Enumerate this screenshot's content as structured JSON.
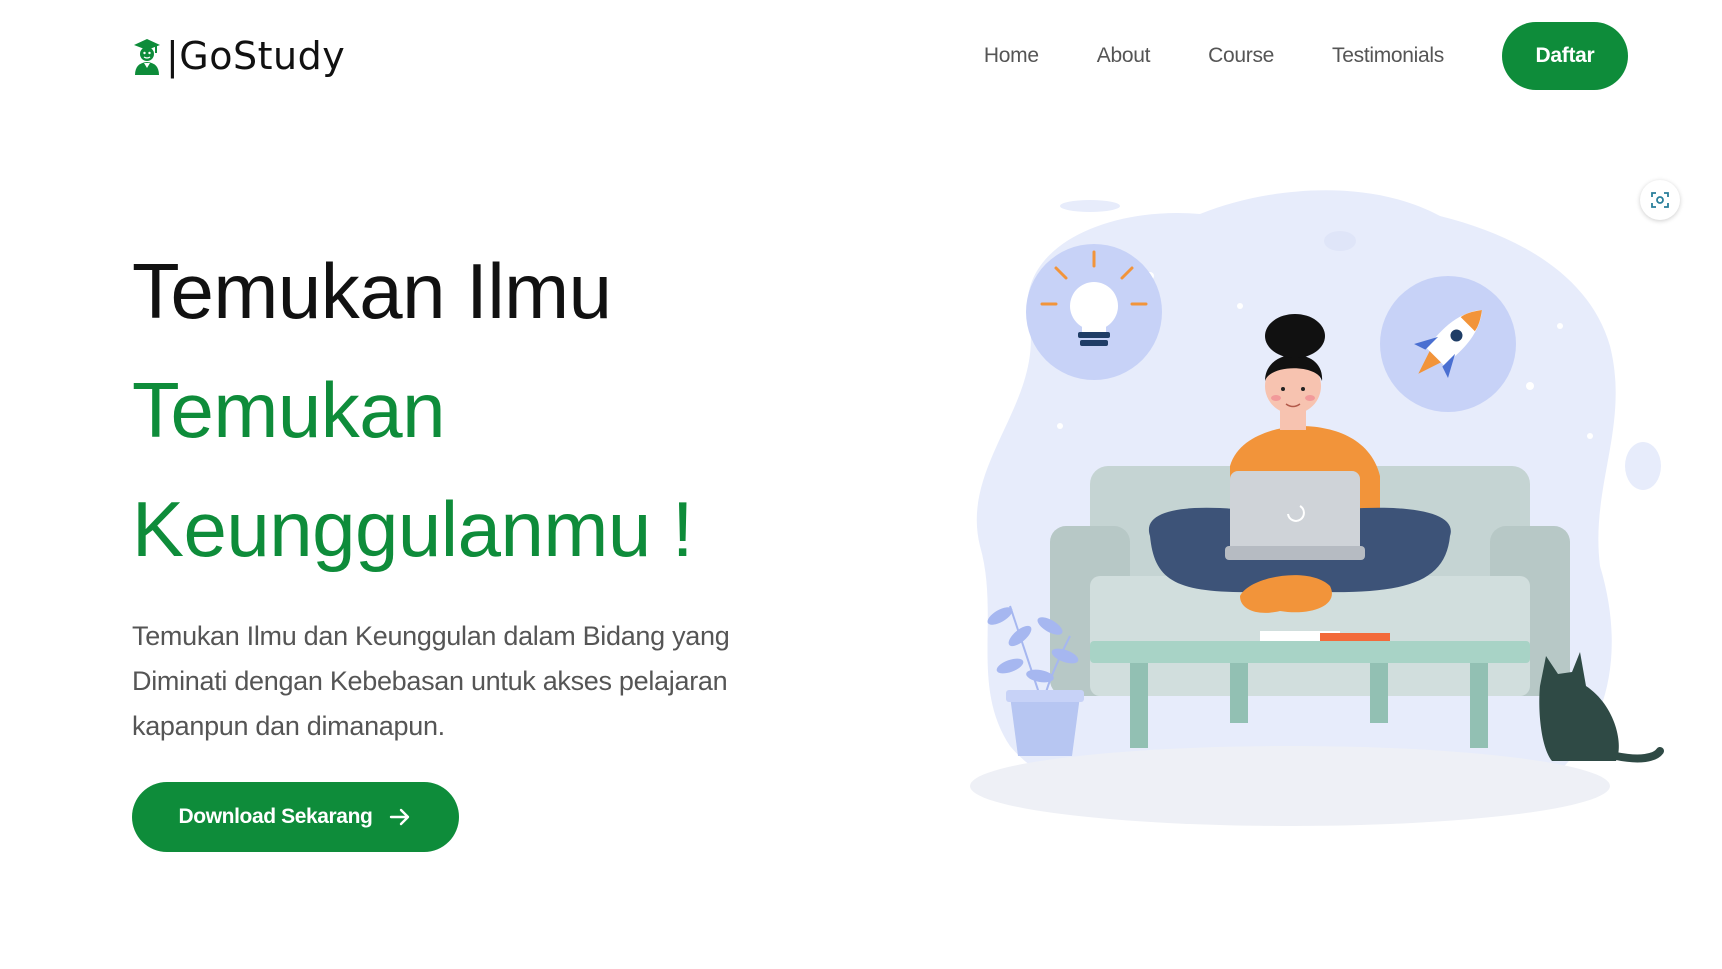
{
  "brand": {
    "name": "|GoStudy",
    "color": "#0e8c3a"
  },
  "nav": {
    "links": [
      "Home",
      "About",
      "Course",
      "Testimonials"
    ],
    "cta": "Daftar"
  },
  "hero": {
    "line1": "Temukan Ilmu",
    "line2": "Temukan",
    "line3": "Keunggulanmu !",
    "description": "Temukan Ilmu dan Keunggulan dalam Bidang yang Diminati dengan Kebebasan untuk akses pelajaran kapanpun dan dimanapun.",
    "button": "Download Sekarang",
    "button_icon": "arrow-right-icon"
  },
  "icons": {
    "logo": "graduate-icon",
    "scan": "scan-icon",
    "lightbulb": "lightbulb-icon",
    "rocket": "rocket-icon"
  }
}
